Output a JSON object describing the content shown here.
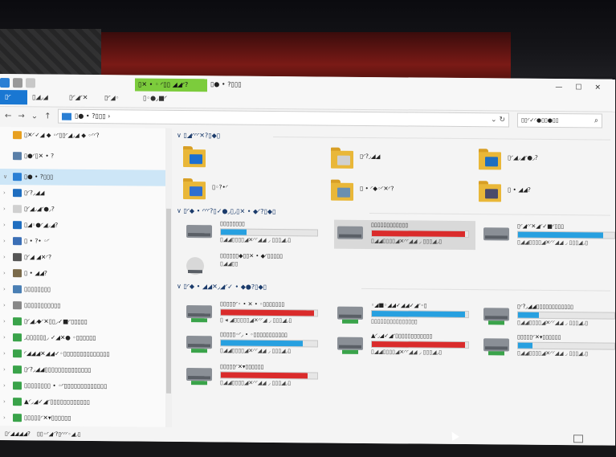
{
  "window": {
    "context_tab": "▯✕ • ◦ ◜▯▯ ◢◢◜?",
    "context_title": "▯● • ?▯▯▯",
    "title_controls": [
      "—",
      "☐",
      "✕"
    ]
  },
  "ribbon": {
    "tabs": [
      {
        "label": "▯◜"
      },
      {
        "label": "▯◢◞◢"
      },
      {
        "label": "▯◜◢◜✕"
      },
      {
        "label": "▯◜◢◦"
      },
      {
        "label": "▯◦●◞■◜"
      }
    ]
  },
  "address": {
    "back": "←",
    "forward": "→",
    "recent": "⌄",
    "up": "↑",
    "path": "▯● • ?▯▯▯ ›",
    "search_placeholder": "▯▯◜✓◜●▯▯●▯▯"
  },
  "sidebar": {
    "items": [
      {
        "label": "▯✕◜✓◢ ◆ ◦◜▯▯◜◢◞◢ ◆ ◦◜◜?",
        "icon_color": "#e8a020",
        "chev": ""
      },
      {
        "label": "▯●◜▯✕ • ?",
        "icon_color": "#5a7fa8",
        "chev": ""
      },
      {
        "label": "▯● • ?▯▯▯",
        "icon_color": "#2a7fd4",
        "chev": "∨",
        "selected": true
      },
      {
        "label": "▯◜?◞◢◢",
        "icon_color": "#1f6ec0",
        "chev": "›"
      },
      {
        "label": "▯◜◢◞◢◜●◞?",
        "icon_color": "#d0d0d0",
        "chev": "›"
      },
      {
        "label": "▯◢◦●◜◢◞◢?",
        "icon_color": "#1f6ec0",
        "chev": "›"
      },
      {
        "label": "▯ • ?• ◦◜",
        "icon_color": "#3b6fb6",
        "chev": "›"
      },
      {
        "label": "▯◜◢ ◢✕◜?",
        "icon_color": "#555",
        "chev": "›"
      },
      {
        "label": "▯ • ◢◢?",
        "icon_color": "#7a6a4a",
        "chev": "›"
      },
      {
        "label": "▯▯▯▯▯▯▯▯",
        "icon_color": "#4a7fb4",
        "chev": "›"
      },
      {
        "label": "▯▯▯▯▯▯▯▯▯▯▯",
        "icon_color": "#888",
        "chev": "›"
      },
      {
        "label": "▯◜◢◞◆◜✕▯▯◞✓■◜▯▯▯▯▯",
        "icon_color": "#3aa34a",
        "chev": "›"
      },
      {
        "label": "◞▯▯▯▯▯▯◞ ✓◢✕● ◦▯▯▯▯▯▯",
        "icon_color": "#3aa34a",
        "chev": "›"
      },
      {
        "label": "◜◢◢◢✕◢◢✓◦▯▯▯▯▯▯▯▯▯▯▯▯▯▯",
        "icon_color": "#3aa34a",
        "chev": "›"
      },
      {
        "label": "▯◜?◞◢◢▯▯▯▯▯▯▯▯▯▯▯▯▯▯",
        "icon_color": "#3aa34a",
        "chev": "›"
      },
      {
        "label": "▯▯▯▯▯▯▯▯ • ◦◜▯▯▯▯▯▯▯▯▯▯▯▯▯",
        "icon_color": "#3aa34a",
        "chev": "›"
      },
      {
        "label": "▲◜◞◢✓◢◜▯▯▯▯▯▯▯▯▯▯▯▯",
        "icon_color": "#3aa34a",
        "chev": "›"
      },
      {
        "label": "▯▯▯▯▯◜✕▾▯▯▯▯▯▯",
        "icon_color": "#3aa34a",
        "chev": "›"
      },
      {
        "label": "▯▯▯▯▯◜✕▾▯▯▯▯▯▯",
        "icon_color": "#3aa34a",
        "chev": "›"
      },
      {
        "label": "▯◜◢◢◜◢✕◞",
        "icon_color": "#3b7fd4",
        "chev": "›"
      }
    ]
  },
  "groups": {
    "folders_header": "▯◢◜◜◜✕?▯◆▯",
    "devices_header": "▯◜◆ • ◜◜◜?▯✓●◞▯◞▯✕ • ◆◜?▯◆▯",
    "network_header": "▯◜◆ • ◢◢✕◞◢◜✓ • ◆●?▯◆▯"
  },
  "folders": [
    {
      "label": "",
      "overlay": "#1c6fd1"
    },
    {
      "label": "▯◜?◞◢◢",
      "overlay": "#d0d0d0"
    },
    {
      "label": "▯◜◢◞◢◜●◞?",
      "overlay": "#1f6ec0"
    },
    {
      "label": "▯◦?•◜",
      "overlay": "#2f6fd0"
    },
    {
      "label": "▯ • ◜◆◦◜✕◜?",
      "overlay": "#6a8fb0"
    },
    {
      "label": "▯ • ◢◢?",
      "overlay": "#4a4a6a"
    }
  ],
  "devices": [
    {
      "name": "▯▯▯▯▯▯▯▯",
      "stats": "▯◢◢▯▯▯▯◢✕◜◜◢◢ ◞ ▯▯▯◢◞▯",
      "fill": 0.27,
      "color": "#27a0e0"
    },
    {
      "name": "▯▯▯▯▯▯▯▯▯▯▯▯",
      "stats": "▯◢◢▯▯▯▯◢✕◜◜◢◢ ◞ ▯▯▯◢◞▯",
      "fill": 0.97,
      "color": "#da2b2b"
    },
    {
      "name": "▯◜◢◜◜✕◢◜✓■◜▯▯▯",
      "stats": "▯◢◢▯▯▯▯◢✕◜◜◢◢ ◞ ▯▯▯◢◞▯",
      "fill": 0.88,
      "color": "#27a0e0"
    },
    {
      "name": "▯▯▯▯▯▯◆▯▯✕ • ◆◜▯▯▯▯▯",
      "stats": "▯◢◢▯▯",
      "fill": null,
      "color": "#27a0e0"
    }
  ],
  "network": [
    {
      "name": "▯▯▯▯▯◜◦ • ✕ • ◦▯▯▯▯▯▯▯",
      "stats": "▯ ◂ ◢▯▯▯▯▯◢✕◜◜◢ ◞ ▯▯▯◢◞▯",
      "fill": 0.97,
      "color": "#da2b2b"
    },
    {
      "name": "◦◢■◦◢◢✓◢◢✓◢◜◦▯",
      "stats": "▯▯▯▯▯▯▯▯▯▯▯▯▯▯▯",
      "fill": 0.97,
      "color": "#27a0e0"
    },
    {
      "name": "▯◜?◞◢◢▯▯▯▯▯▯▯▯▯▯▯▯",
      "stats": "▯◢◢▯▯▯▯◢✕◜◜◢◢ ◞ ▯▯▯◢◞▯",
      "fill": 0.22,
      "color": "#27a0e0"
    },
    {
      "name": "▯▯▯▯▯◦◜◞ • ◦▯▯▯▯▯▯▯▯▯▯▯",
      "stats": "▯◢◢▯▯▯▯◢✕◜◜◢◢ ◞ ▯▯▯◢◞▯",
      "fill": 0.85,
      "color": "#27a0e0"
    },
    {
      "name": "▲◜◞◢✓◢◜▯▯▯▯▯▯▯▯▯▯▯▯",
      "stats": "▯◢◢▯▯▯▯◢✕◜◜◢◢ ◞ ▯▯▯◢◞▯",
      "fill": 0.97,
      "color": "#da2b2b"
    },
    {
      "name": "▯▯▯▯▯◜✕▾▯▯▯▯▯▯",
      "stats": "▯◢◢▯▯▯▯◢✕◜◜◢◢ ◞ ▯▯▯◢◞▯",
      "fill": 0.15,
      "color": "#27a0e0"
    },
    {
      "name": "▯▯▯▯▯◜✕▾▯▯▯▯▯▯",
      "stats": "▯◢◢▯▯▯▯◢✕◜◜◢◢ ◞ ▯▯▯◢◞▯",
      "fill": 0.9,
      "color": "#da2b2b"
    }
  ],
  "status": {
    "items": "▯◜◢◢◢◢?",
    "selection": "▯▯◦◜◢◜?▯◜◜◜◦◢◞▯"
  }
}
